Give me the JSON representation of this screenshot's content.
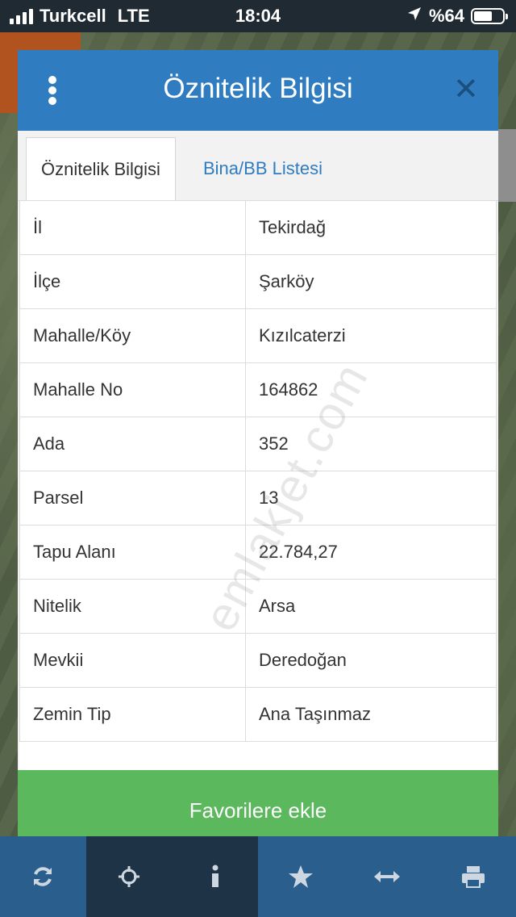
{
  "status_bar": {
    "carrier": "Turkcell",
    "network": "LTE",
    "time": "18:04",
    "battery": "%64",
    "battery_level": 0.64
  },
  "modal": {
    "title": "Öznitelik Bilgisi",
    "tabs": [
      {
        "label": "Öznitelik Bilgisi",
        "active": true
      },
      {
        "label": "Bina/BB Listesi",
        "active": false
      }
    ],
    "rows": [
      {
        "key": "İl",
        "value": "Tekirdağ"
      },
      {
        "key": "İlçe",
        "value": "Şarköy"
      },
      {
        "key": "Mahalle/Köy",
        "value": "Kızılcaterzi"
      },
      {
        "key": "Mahalle No",
        "value": "164862"
      },
      {
        "key": "Ada",
        "value": "352"
      },
      {
        "key": "Parsel",
        "value": "13"
      },
      {
        "key": "Tapu Alanı",
        "value": "22.784,27"
      },
      {
        "key": "Nitelik",
        "value": "Arsa"
      },
      {
        "key": "Mevkii",
        "value": "Deredoğan"
      },
      {
        "key": "Zemin Tip",
        "value": "Ana Taşınmaz"
      }
    ],
    "favorite_button": "Favorilere ekle"
  },
  "watermark": "emlakjet.com",
  "toolbar": [
    "refresh-icon",
    "crosshair-icon",
    "info-icon",
    "star-icon",
    "arrows-horizontal-icon",
    "print-icon"
  ],
  "colors": {
    "header": "#2f7cc1",
    "favorite": "#5bb85c",
    "toolbar": "#2a5e8c"
  }
}
